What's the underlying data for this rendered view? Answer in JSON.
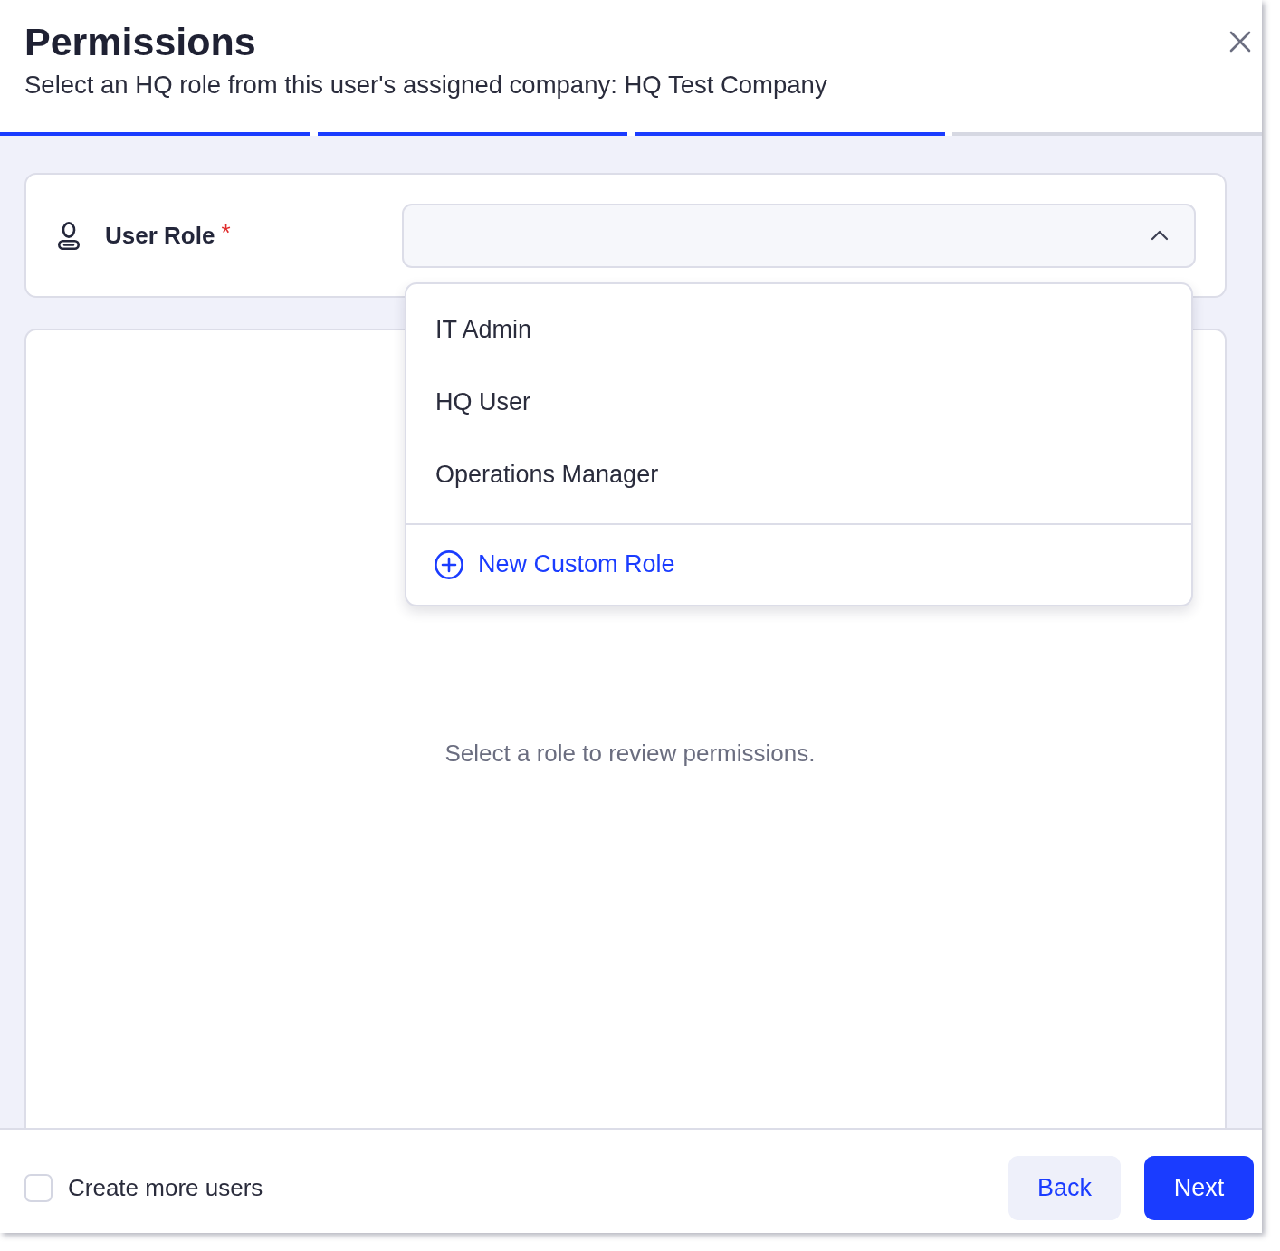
{
  "dialog": {
    "title": "Permissions",
    "subtitle": "Select an HQ role from this user's assigned company: HQ Test Company"
  },
  "progress_steps": [
    {
      "completed": true
    },
    {
      "completed": true
    },
    {
      "completed": true
    },
    {
      "completed": false
    }
  ],
  "role_field": {
    "label": "User Role",
    "required_mark": "*",
    "expanded": true,
    "options": [
      {
        "label": "IT Admin",
        "selected": false
      },
      {
        "label": "HQ User",
        "selected": false
      },
      {
        "label": "Operations Manager",
        "selected": false
      }
    ],
    "create_action": "New Custom Role"
  },
  "permissions_panel": {
    "empty_message": "Select a role to review permissions."
  },
  "footer": {
    "create_more": {
      "label": "Create more users",
      "checked": false
    },
    "buttons": [
      {
        "label": "Back",
        "kind": "secondary"
      },
      {
        "label": "Next",
        "kind": "primary"
      }
    ]
  }
}
